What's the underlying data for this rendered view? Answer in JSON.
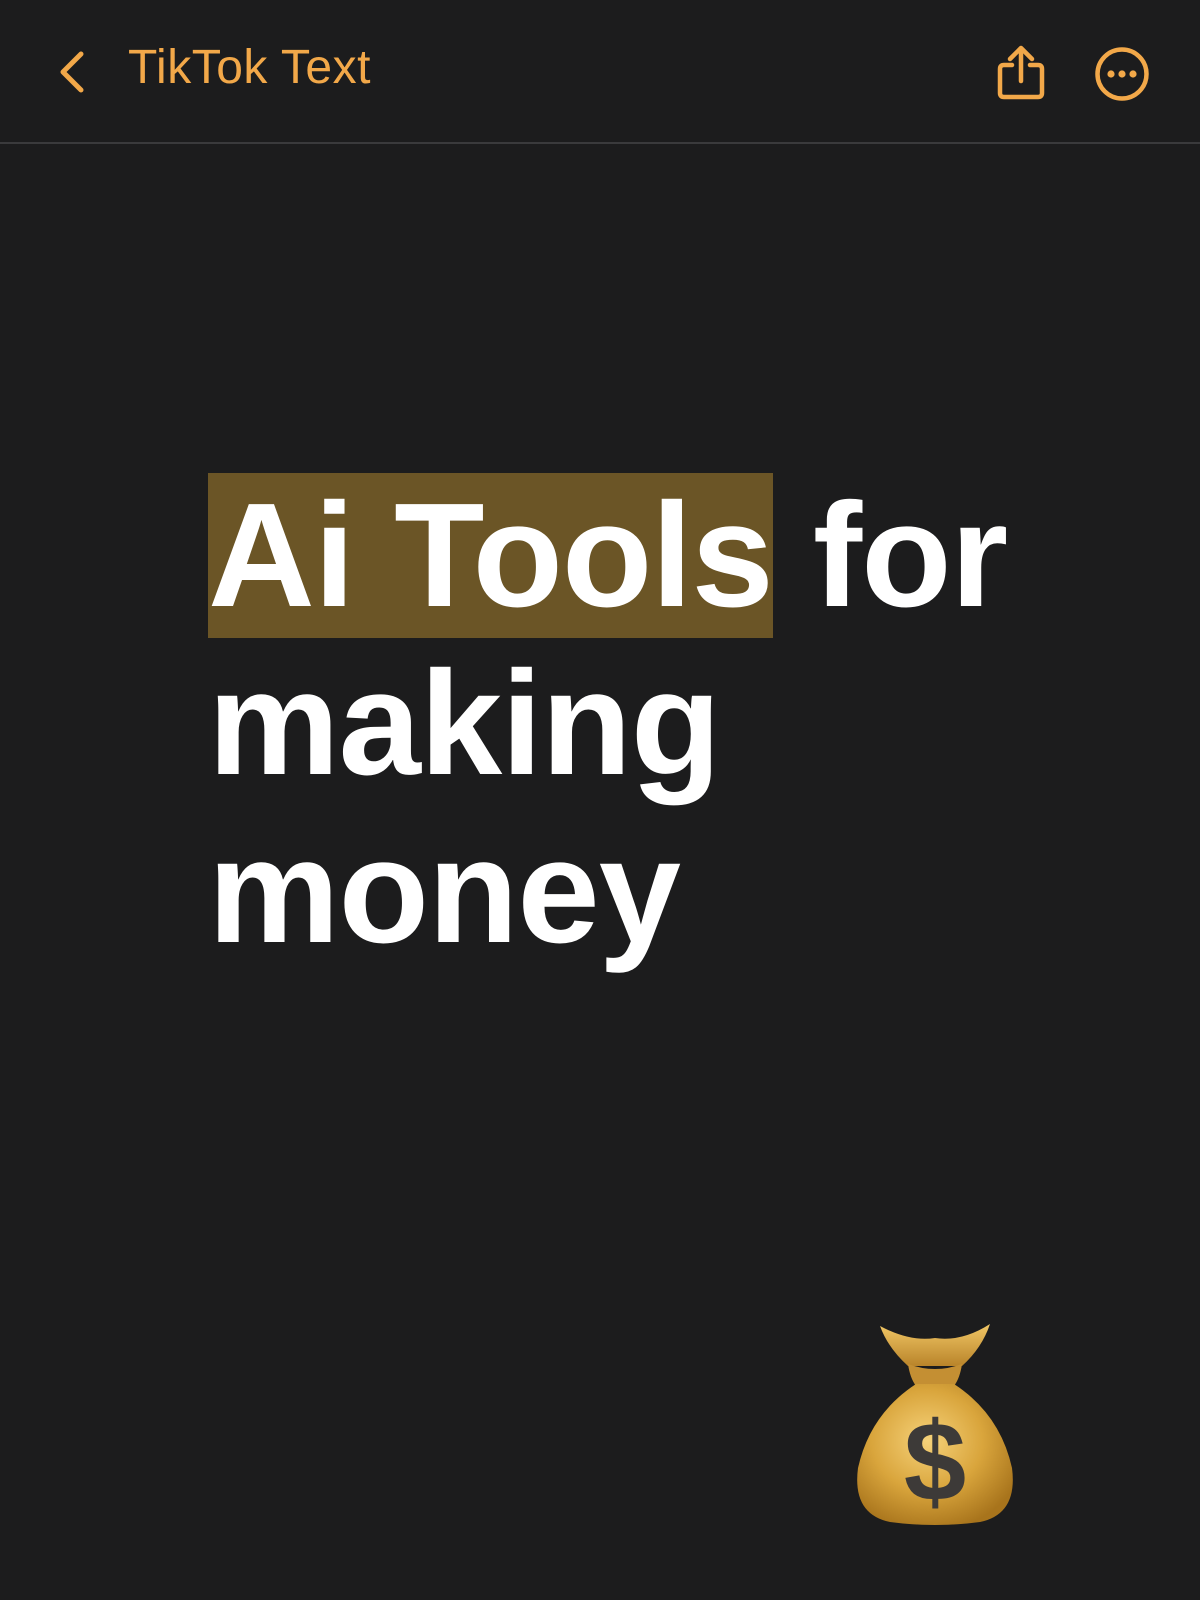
{
  "nav": {
    "title": "TikTok Text",
    "back_icon": "chevron-left-icon",
    "share_icon": "share-icon",
    "more_icon": "ellipsis-circle-icon"
  },
  "note": {
    "highlighted_text": "Ai Tools",
    "line1_rest": " for",
    "line2": "making",
    "line3": "money",
    "emoji_icon": "money-bag-icon"
  },
  "colors": {
    "background": "#1c1c1d",
    "accent": "#f2a849",
    "highlight": "#6b5526",
    "text": "#ffffff"
  }
}
